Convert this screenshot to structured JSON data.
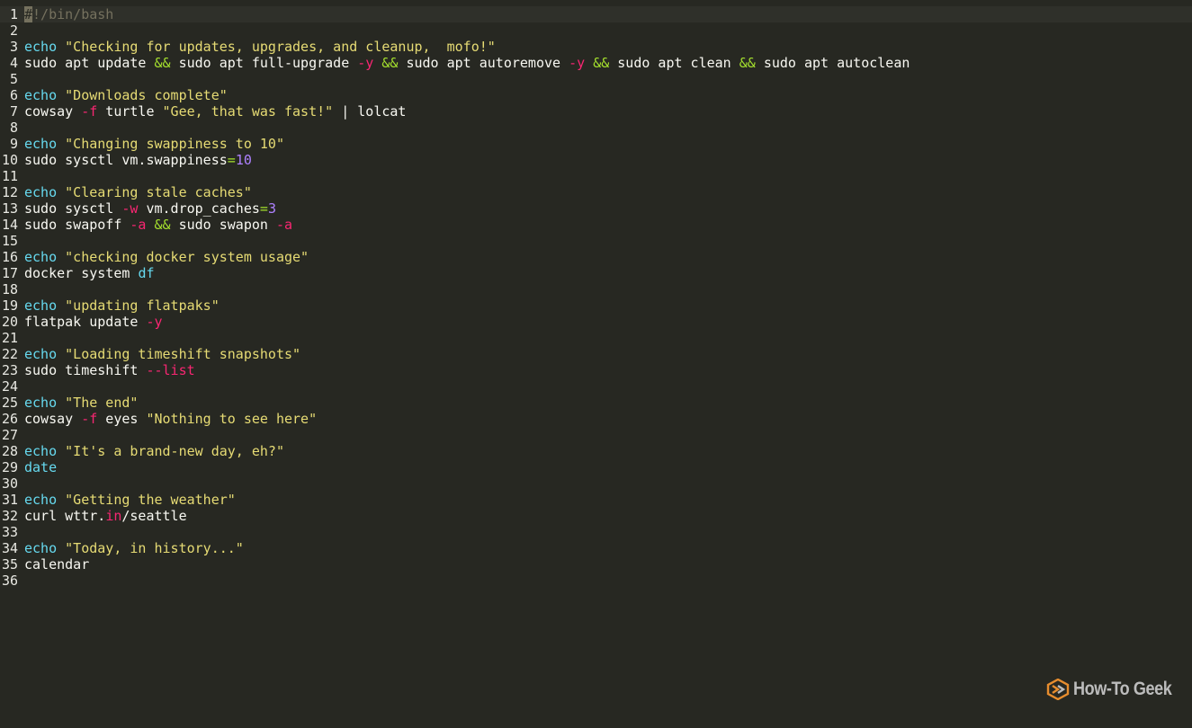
{
  "colors": {
    "background": "#272822",
    "comment": "#75715e",
    "builtin": "#66d9ef",
    "string": "#e6db74",
    "operator": "#a6e22e",
    "flag": "#f92672",
    "number": "#ae81ff",
    "plain": "#f8f8f2",
    "logo_accent": "#e78d2e"
  },
  "editor": {
    "lines": [
      {
        "n": "1",
        "tokens": [
          {
            "t": "#",
            "k": "cursor"
          },
          {
            "t": "!/bin/bash",
            "k": "comment"
          }
        ]
      },
      {
        "n": "2",
        "tokens": []
      },
      {
        "n": "3",
        "tokens": [
          {
            "t": "echo",
            "k": "builtin"
          },
          {
            "t": " ",
            "k": "plain"
          },
          {
            "t": "\"Checking for updates, upgrades, and cleanup,  mofo!\"",
            "k": "string"
          }
        ]
      },
      {
        "n": "4",
        "tokens": [
          {
            "t": "sudo apt update ",
            "k": "plain"
          },
          {
            "t": "&&",
            "k": "op"
          },
          {
            "t": " sudo apt full-upgrade ",
            "k": "plain"
          },
          {
            "t": "-y",
            "k": "flag"
          },
          {
            "t": " ",
            "k": "plain"
          },
          {
            "t": "&&",
            "k": "op"
          },
          {
            "t": " sudo apt autoremove ",
            "k": "plain"
          },
          {
            "t": "-y",
            "k": "flag"
          },
          {
            "t": " ",
            "k": "plain"
          },
          {
            "t": "&&",
            "k": "op"
          },
          {
            "t": " sudo apt clean ",
            "k": "plain"
          },
          {
            "t": "&&",
            "k": "op"
          },
          {
            "t": " sudo apt autoclean",
            "k": "plain"
          }
        ]
      },
      {
        "n": "5",
        "tokens": []
      },
      {
        "n": "6",
        "tokens": [
          {
            "t": "echo",
            "k": "builtin"
          },
          {
            "t": " ",
            "k": "plain"
          },
          {
            "t": "\"Downloads complete\"",
            "k": "string"
          }
        ]
      },
      {
        "n": "7",
        "tokens": [
          {
            "t": "cowsay ",
            "k": "plain"
          },
          {
            "t": "-f",
            "k": "flag"
          },
          {
            "t": " turtle ",
            "k": "plain"
          },
          {
            "t": "\"Gee, that was fast!\"",
            "k": "string"
          },
          {
            "t": " | lolcat",
            "k": "plain"
          }
        ]
      },
      {
        "n": "8",
        "tokens": []
      },
      {
        "n": "9",
        "tokens": [
          {
            "t": "echo",
            "k": "builtin"
          },
          {
            "t": " ",
            "k": "plain"
          },
          {
            "t": "\"Changing swappiness to 10\"",
            "k": "string"
          }
        ]
      },
      {
        "n": "10",
        "tokens": [
          {
            "t": "sudo sysctl vm.swappiness",
            "k": "plain"
          },
          {
            "t": "=",
            "k": "op"
          },
          {
            "t": "10",
            "k": "num"
          }
        ]
      },
      {
        "n": "11",
        "tokens": []
      },
      {
        "n": "12",
        "tokens": [
          {
            "t": "echo",
            "k": "builtin"
          },
          {
            "t": " ",
            "k": "plain"
          },
          {
            "t": "\"Clearing stale caches\"",
            "k": "string"
          }
        ]
      },
      {
        "n": "13",
        "tokens": [
          {
            "t": "sudo sysctl ",
            "k": "plain"
          },
          {
            "t": "-w",
            "k": "flag"
          },
          {
            "t": " vm.drop_caches",
            "k": "plain"
          },
          {
            "t": "=",
            "k": "op"
          },
          {
            "t": "3",
            "k": "num"
          }
        ]
      },
      {
        "n": "14",
        "tokens": [
          {
            "t": "sudo swapoff ",
            "k": "plain"
          },
          {
            "t": "-a",
            "k": "flag"
          },
          {
            "t": " ",
            "k": "plain"
          },
          {
            "t": "&&",
            "k": "op"
          },
          {
            "t": " sudo swapon ",
            "k": "plain"
          },
          {
            "t": "-a",
            "k": "flag"
          }
        ]
      },
      {
        "n": "15",
        "tokens": []
      },
      {
        "n": "16",
        "tokens": [
          {
            "t": "echo",
            "k": "builtin"
          },
          {
            "t": " ",
            "k": "plain"
          },
          {
            "t": "\"checking docker system usage\"",
            "k": "string"
          }
        ]
      },
      {
        "n": "17",
        "tokens": [
          {
            "t": "docker system ",
            "k": "plain"
          },
          {
            "t": "df",
            "k": "builtin"
          }
        ]
      },
      {
        "n": "18",
        "tokens": []
      },
      {
        "n": "19",
        "tokens": [
          {
            "t": "echo",
            "k": "builtin"
          },
          {
            "t": " ",
            "k": "plain"
          },
          {
            "t": "\"updating flatpaks\"",
            "k": "string"
          }
        ]
      },
      {
        "n": "20",
        "tokens": [
          {
            "t": "flatpak update ",
            "k": "plain"
          },
          {
            "t": "-y",
            "k": "flag"
          }
        ]
      },
      {
        "n": "21",
        "tokens": []
      },
      {
        "n": "22",
        "tokens": [
          {
            "t": "echo",
            "k": "builtin"
          },
          {
            "t": " ",
            "k": "plain"
          },
          {
            "t": "\"Loading timeshift snapshots\"",
            "k": "string"
          }
        ]
      },
      {
        "n": "23",
        "tokens": [
          {
            "t": "sudo timeshift ",
            "k": "plain"
          },
          {
            "t": "--list",
            "k": "flag"
          }
        ]
      },
      {
        "n": "24",
        "tokens": []
      },
      {
        "n": "25",
        "tokens": [
          {
            "t": "echo",
            "k": "builtin"
          },
          {
            "t": " ",
            "k": "plain"
          },
          {
            "t": "\"The end\"",
            "k": "string"
          }
        ]
      },
      {
        "n": "26",
        "tokens": [
          {
            "t": "cowsay ",
            "k": "plain"
          },
          {
            "t": "-f",
            "k": "flag"
          },
          {
            "t": " eyes ",
            "k": "plain"
          },
          {
            "t": "\"Nothing to see here\"",
            "k": "string"
          }
        ]
      },
      {
        "n": "27",
        "tokens": []
      },
      {
        "n": "28",
        "tokens": [
          {
            "t": "echo",
            "k": "builtin"
          },
          {
            "t": " ",
            "k": "plain"
          },
          {
            "t": "\"It's a brand-new day, eh?\"",
            "k": "string"
          }
        ]
      },
      {
        "n": "29",
        "tokens": [
          {
            "t": "date",
            "k": "builtin"
          }
        ]
      },
      {
        "n": "30",
        "tokens": []
      },
      {
        "n": "31",
        "tokens": [
          {
            "t": "echo",
            "k": "builtin"
          },
          {
            "t": " ",
            "k": "plain"
          },
          {
            "t": "\"Getting the weather\"",
            "k": "string"
          }
        ]
      },
      {
        "n": "32",
        "tokens": [
          {
            "t": "curl wttr.",
            "k": "plain"
          },
          {
            "t": "in",
            "k": "flag"
          },
          {
            "t": "/seattle",
            "k": "plain"
          }
        ]
      },
      {
        "n": "33",
        "tokens": []
      },
      {
        "n": "34",
        "tokens": [
          {
            "t": "echo",
            "k": "builtin"
          },
          {
            "t": " ",
            "k": "plain"
          },
          {
            "t": "\"Today, in history...\"",
            "k": "string"
          }
        ]
      },
      {
        "n": "35",
        "tokens": [
          {
            "t": "calendar",
            "k": "plain"
          }
        ]
      },
      {
        "n": "36",
        "tokens": []
      }
    ]
  },
  "watermark": {
    "text": "How-To Geek",
    "icon": "htg-logo-icon"
  }
}
